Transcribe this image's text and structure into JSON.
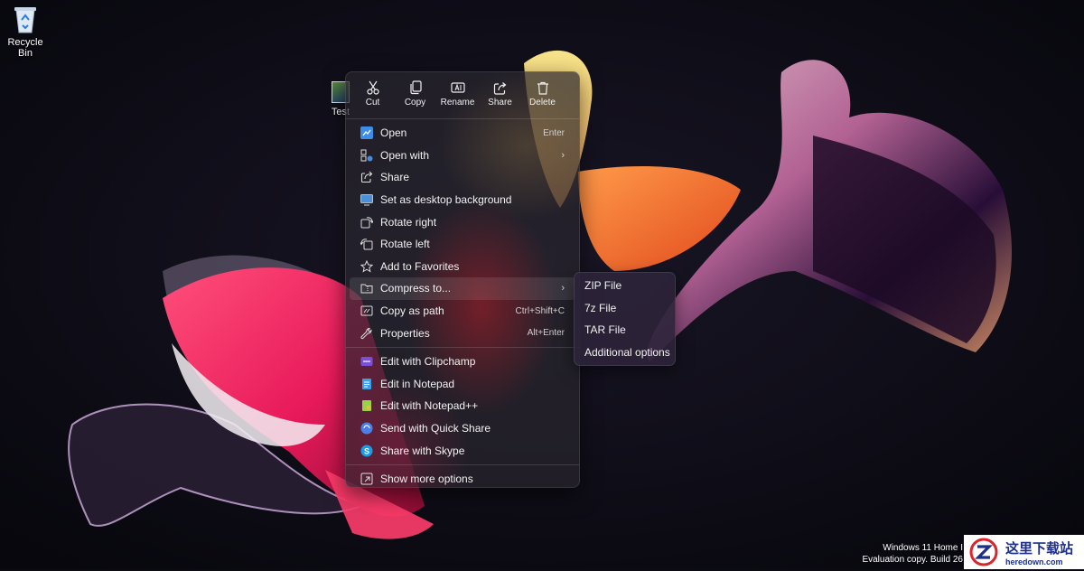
{
  "desktop": {
    "recycle_bin_label": "Recycle Bin",
    "file_label": "Test"
  },
  "context_menu": {
    "toolbar": [
      {
        "label": "Cut",
        "icon": "scissors-icon"
      },
      {
        "label": "Copy",
        "icon": "copy-icon"
      },
      {
        "label": "Rename",
        "icon": "rename-icon"
      },
      {
        "label": "Share",
        "icon": "share-icon"
      },
      {
        "label": "Delete",
        "icon": "trash-icon"
      }
    ],
    "items": [
      {
        "label": "Open",
        "shortcut": "Enter",
        "icon": "open-icon"
      },
      {
        "label": "Open with",
        "shortcut": "",
        "icon": "open-with-icon",
        "submenu": true
      },
      {
        "label": "Share",
        "shortcut": "",
        "icon": "share-icon"
      },
      {
        "label": "Set as desktop background",
        "shortcut": "",
        "icon": "desktop-background-icon"
      },
      {
        "label": "Rotate right",
        "shortcut": "",
        "icon": "rotate-right-icon"
      },
      {
        "label": "Rotate left",
        "shortcut": "",
        "icon": "rotate-left-icon"
      },
      {
        "label": "Add to Favorites",
        "shortcut": "",
        "icon": "star-icon"
      },
      {
        "label": "Compress to...",
        "shortcut": "",
        "icon": "zip-folder-icon",
        "submenu": true
      },
      {
        "label": "Copy as path",
        "shortcut": "Ctrl+Shift+C",
        "icon": "copy-path-icon"
      },
      {
        "label": "Properties",
        "shortcut": "Alt+Enter",
        "icon": "wrench-icon"
      },
      {
        "label": "Edit with Clipchamp",
        "shortcut": "",
        "icon": "clipchamp-icon"
      },
      {
        "label": "Edit in Notepad",
        "shortcut": "",
        "icon": "notepad-icon"
      },
      {
        "label": "Edit with Notepad++",
        "shortcut": "",
        "icon": "notepad-plus-plus-icon"
      },
      {
        "label": "Send with Quick Share",
        "shortcut": "",
        "icon": "quick-share-icon"
      },
      {
        "label": "Share with Skype",
        "shortcut": "",
        "icon": "skype-icon"
      },
      {
        "label": "Show more options",
        "shortcut": "",
        "icon": "more-options-icon"
      }
    ]
  },
  "compress_submenu": {
    "items": [
      "ZIP File",
      "7z File",
      "TAR File",
      "Additional options"
    ]
  },
  "watermark": {
    "line1": "Windows 11 Home I",
    "line2": "Evaluation copy. Build 26"
  },
  "brand": {
    "chinese": "这里下载站",
    "domain": "heredown.com"
  },
  "colors": {
    "menu_bg": "#28262e",
    "accent_blue": "#3c8ee8",
    "desktop_bg": "#0b0b14"
  }
}
